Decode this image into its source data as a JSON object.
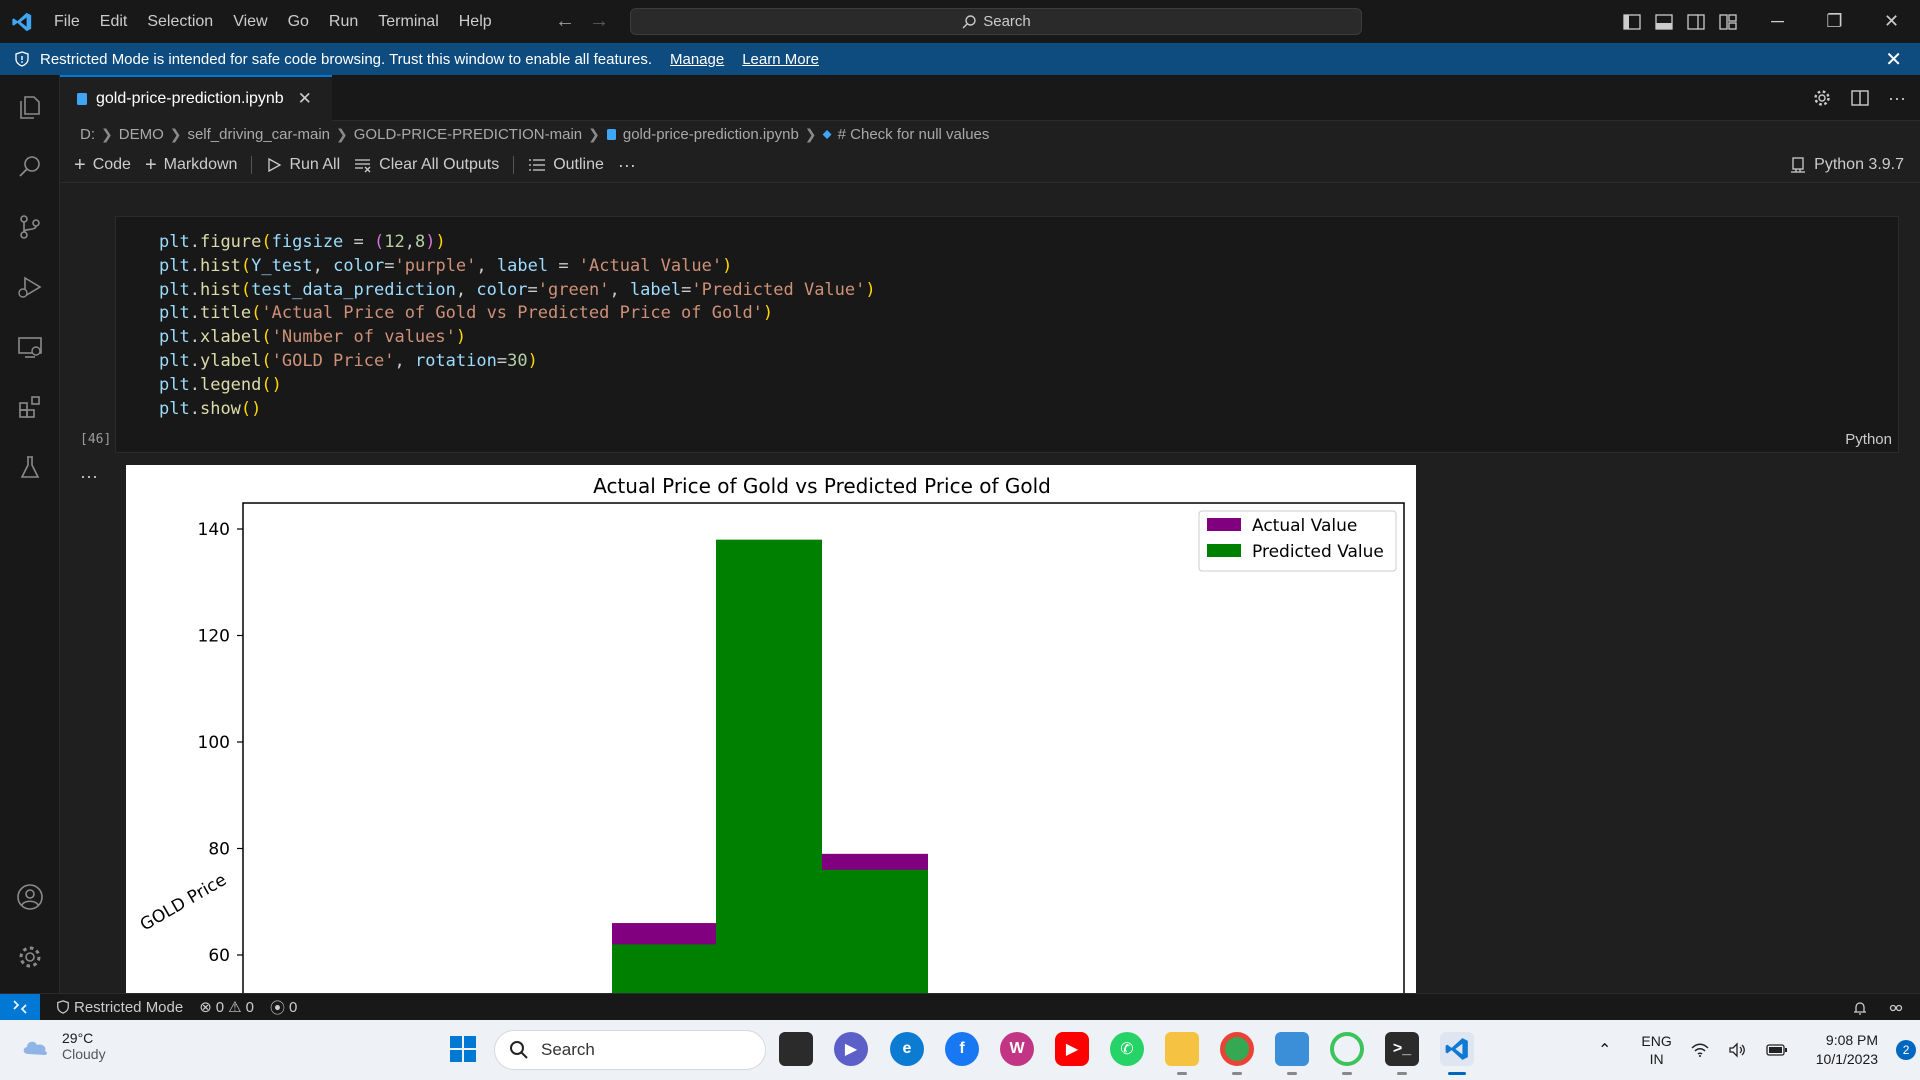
{
  "titlebar": {
    "menu": [
      "File",
      "Edit",
      "Selection",
      "View",
      "Go",
      "Run",
      "Terminal",
      "Help"
    ],
    "search_label": "Search"
  },
  "banner": {
    "message": "Restricted Mode is intended for safe code browsing. Trust this window to enable all features.",
    "manage": "Manage",
    "learn_more": "Learn More"
  },
  "tab": {
    "filename": "gold-price-prediction.ipynb"
  },
  "breadcrumb": [
    "D:",
    "DEMO",
    "self_driving_car-main",
    "GOLD-PRICE-PREDICTION-main",
    "gold-price-prediction.ipynb",
    "# Check for null values"
  ],
  "toolbar": {
    "code": "Code",
    "markdown": "Markdown",
    "run_all": "Run All",
    "clear_outputs": "Clear All Outputs",
    "outline": "Outline",
    "more": "···",
    "kernel": "Python 3.9.7"
  },
  "cell": {
    "execution_count": "[46]",
    "language": "Python",
    "output_more": "···"
  },
  "chart_data": {
    "type": "bar",
    "title": "Actual Price of Gold vs Predicted Price of Gold",
    "xlabel": "",
    "ylabel": "GOLD Price",
    "yticks": [
      60,
      80,
      100,
      120,
      140
    ],
    "legend_position": "top-right",
    "colors": {
      "Actual Value": "#800080",
      "Predicted Value": "#008000"
    },
    "series": [
      {
        "name": "Actual Value",
        "values": [
          66,
          137,
          79
        ]
      },
      {
        "name": "Predicted Value",
        "values": [
          62,
          138,
          76
        ]
      }
    ],
    "legend": [
      "Actual Value",
      "Predicted Value"
    ]
  },
  "statusbar": {
    "restricted": "Restricted Mode",
    "errors": "0",
    "warnings": "0",
    "ports": "0"
  },
  "taskbar": {
    "temperature": "29°C",
    "condition": "Cloudy",
    "search_label": "Search",
    "lang_line1": "ENG",
    "lang_line2": "IN",
    "time": "9:08 PM",
    "date": "10/1/2023",
    "notifications": "2"
  }
}
